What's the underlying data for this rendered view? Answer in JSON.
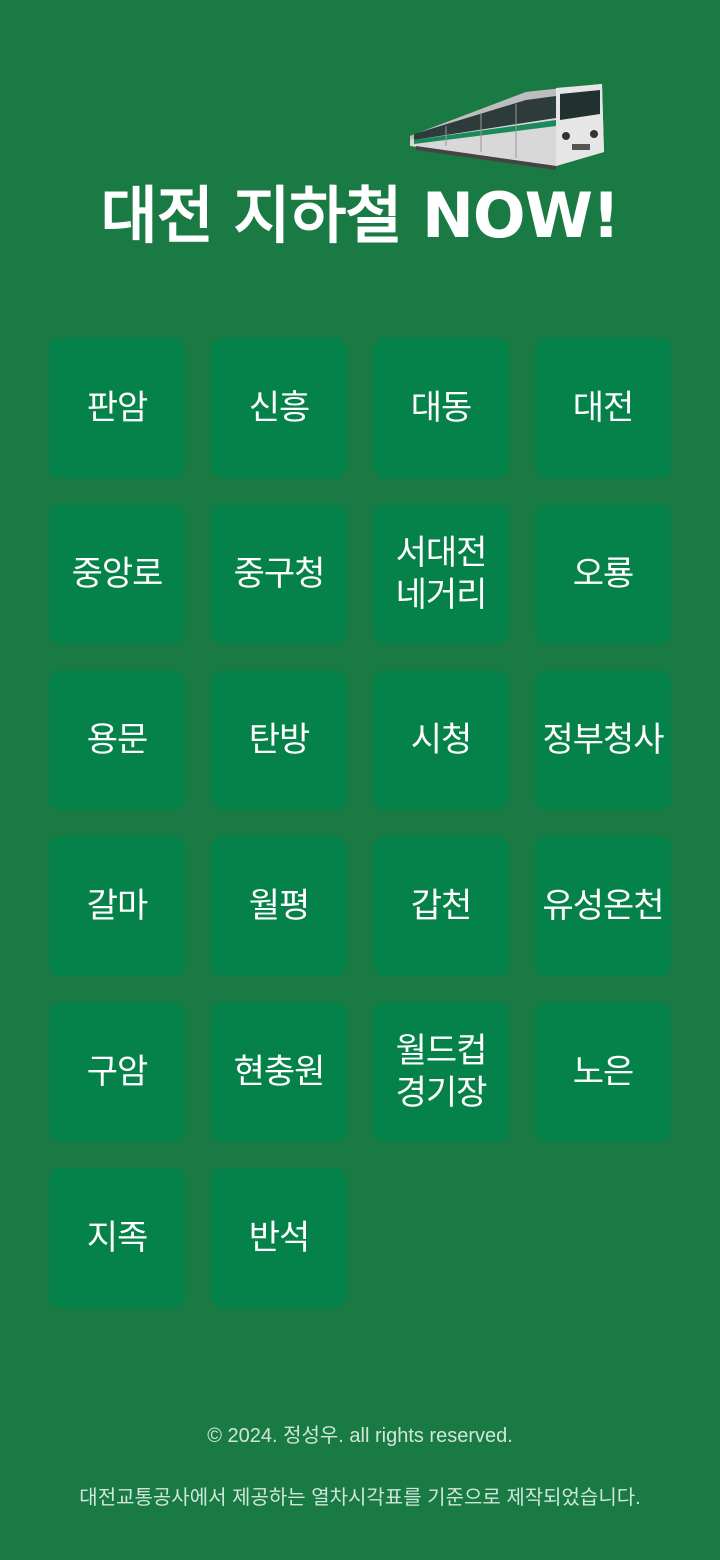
{
  "app": {
    "title": "대전 지하철 NOW!"
  },
  "stations": [
    {
      "name": "판암"
    },
    {
      "name": "신흥"
    },
    {
      "name": "대동"
    },
    {
      "name": "대전"
    },
    {
      "name": "중앙로"
    },
    {
      "name": "중구청"
    },
    {
      "name": "서대전\n네거리"
    },
    {
      "name": "오룡"
    },
    {
      "name": "용문"
    },
    {
      "name": "탄방"
    },
    {
      "name": "시청"
    },
    {
      "name": "정부청사"
    },
    {
      "name": "갈마"
    },
    {
      "name": "월평"
    },
    {
      "name": "갑천"
    },
    {
      "name": "유성온천"
    },
    {
      "name": "구암"
    },
    {
      "name": "현충원"
    },
    {
      "name": "월드컵\n경기장"
    },
    {
      "name": "노은"
    },
    {
      "name": "지족"
    },
    {
      "name": "반석"
    }
  ],
  "footer": {
    "copyright": "© 2024. 정성우. all rights reserved.",
    "notice": "대전교통공사에서 제공하는 열차시각표를 기준으로 제작되었습니다."
  },
  "colors": {
    "background": "#197a43",
    "tile": "#05824a",
    "text": "#ffffff"
  },
  "icons": {
    "header_image": "subway-train-icon"
  }
}
